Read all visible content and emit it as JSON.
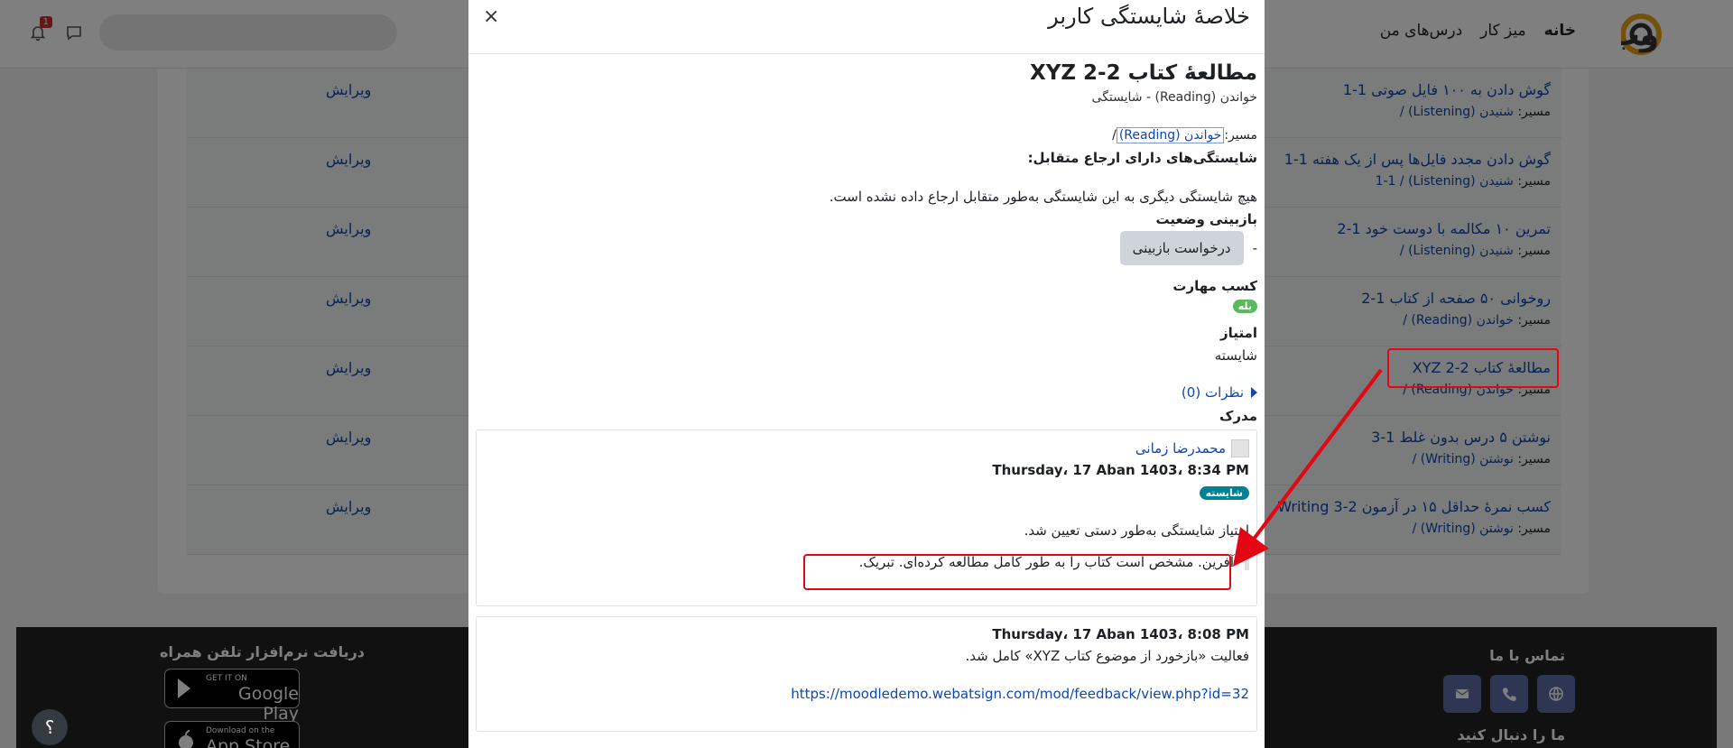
{
  "navbar": {
    "links": [
      "خانه",
      "میز کار",
      "درس‌های من"
    ],
    "notification_count": "1"
  },
  "background_rows": [
    {
      "title": "گوش دادن به ۱۰۰ فایل صوتی 1-1",
      "path_prefix": "مسیر:",
      "path": "شنیدن (Listening) /",
      "edit": "ویرایش"
    },
    {
      "title": "گوش دادن مجدد فایل‌ها پس از یک هفته 1-1",
      "path_prefix": "مسیر:",
      "path": "شنیدن (Listening) / 1-1",
      "edit": "ویرایش"
    },
    {
      "title": "تمرین ۱۰ مکالمه با دوست خود 1-2",
      "path_prefix": "مسیر:",
      "path": "شنیدن (Listening) /",
      "edit": "ویرایش"
    },
    {
      "title": "روخوانی ۵۰ صفحه از کتاب 1-2",
      "path_prefix": "مسیر:",
      "path": "خواندن (Reading) /",
      "edit": "ویرایش"
    },
    {
      "title": "مطالعهٔ کتاب XYZ 2-2",
      "path_prefix": "مسیر:",
      "path": "خواندن (Reading) /",
      "edit": "ویرایش"
    },
    {
      "title": "نوشتن ۵ درس بدون غلط 1-3",
      "path_prefix": "مسیر:",
      "path": "نوشتن (Writing) /",
      "edit": "ویرایش"
    },
    {
      "title": "کسب نمرهٔ حداقل ۱۵ در آزمون Writing 3-2",
      "path_prefix": "مسیر:",
      "path": "نوشتن (Writing) /",
      "edit": "ویرایش"
    }
  ],
  "footer": {
    "contact_title": "تماس با ما",
    "follow_title": "ما را دنبال کنید",
    "app_title": "دریافت نرم‌افزار تلفن همراه",
    "google_small": "GET IT ON",
    "google_big": "Google Play",
    "apple_small": "Download on the",
    "apple_big": "App Store",
    "help": "؟"
  },
  "modal": {
    "title": "خلاصهٔ شایستگی کاربر",
    "close": "×",
    "competency_title": "مطالعهٔ کتاب XYZ 2-2",
    "competency_subtitle": "خواندن (Reading) - شایستگی",
    "path_label": "مسیر:",
    "path_link": "خواندن (Reading)",
    "path_suffix": "/",
    "related_title": "شایستگی‌های دارای ارجاع متقابل:",
    "related_none": "هیچ شایستگی دیگری به این شایستگی به‌طور متقابل ارجاع داده نشده است.",
    "review_title": "بازبینی وضعیت",
    "review_dash": "-",
    "review_button": "درخواست بازبینی",
    "skill_title": "کسب مهارت",
    "skill_value": "بله",
    "score_title": "امتیاز",
    "score_value": "شایسته",
    "comments": "نظرات (0)",
    "evidence_title": "مدرک",
    "evidence": [
      {
        "user": "محمدرضا زمانی",
        "date": "Thursday، 17 Aban 1403، 8:34 PM",
        "badge": "شایسته",
        "desc": "امتیاز شایستگی به‌طور دستی تعیین شد.",
        "quote": "آفرین. مشخص است کتاب را به طور کامل مطالعه کرده‌ای. تبریک."
      },
      {
        "date": "Thursday، 17 Aban 1403، 8:08 PM",
        "desc": "فعالیت «بازخورد از موضوع کتاب XYZ» کامل شد.",
        "link": "https://moodledemo.webatsign.com/mod/feedback/view.php?id=32"
      }
    ]
  },
  "colors": {
    "link": "#0f47ad",
    "highlight": "#e30613",
    "badge_green": "#5cb85c",
    "badge_teal": "#008196"
  }
}
